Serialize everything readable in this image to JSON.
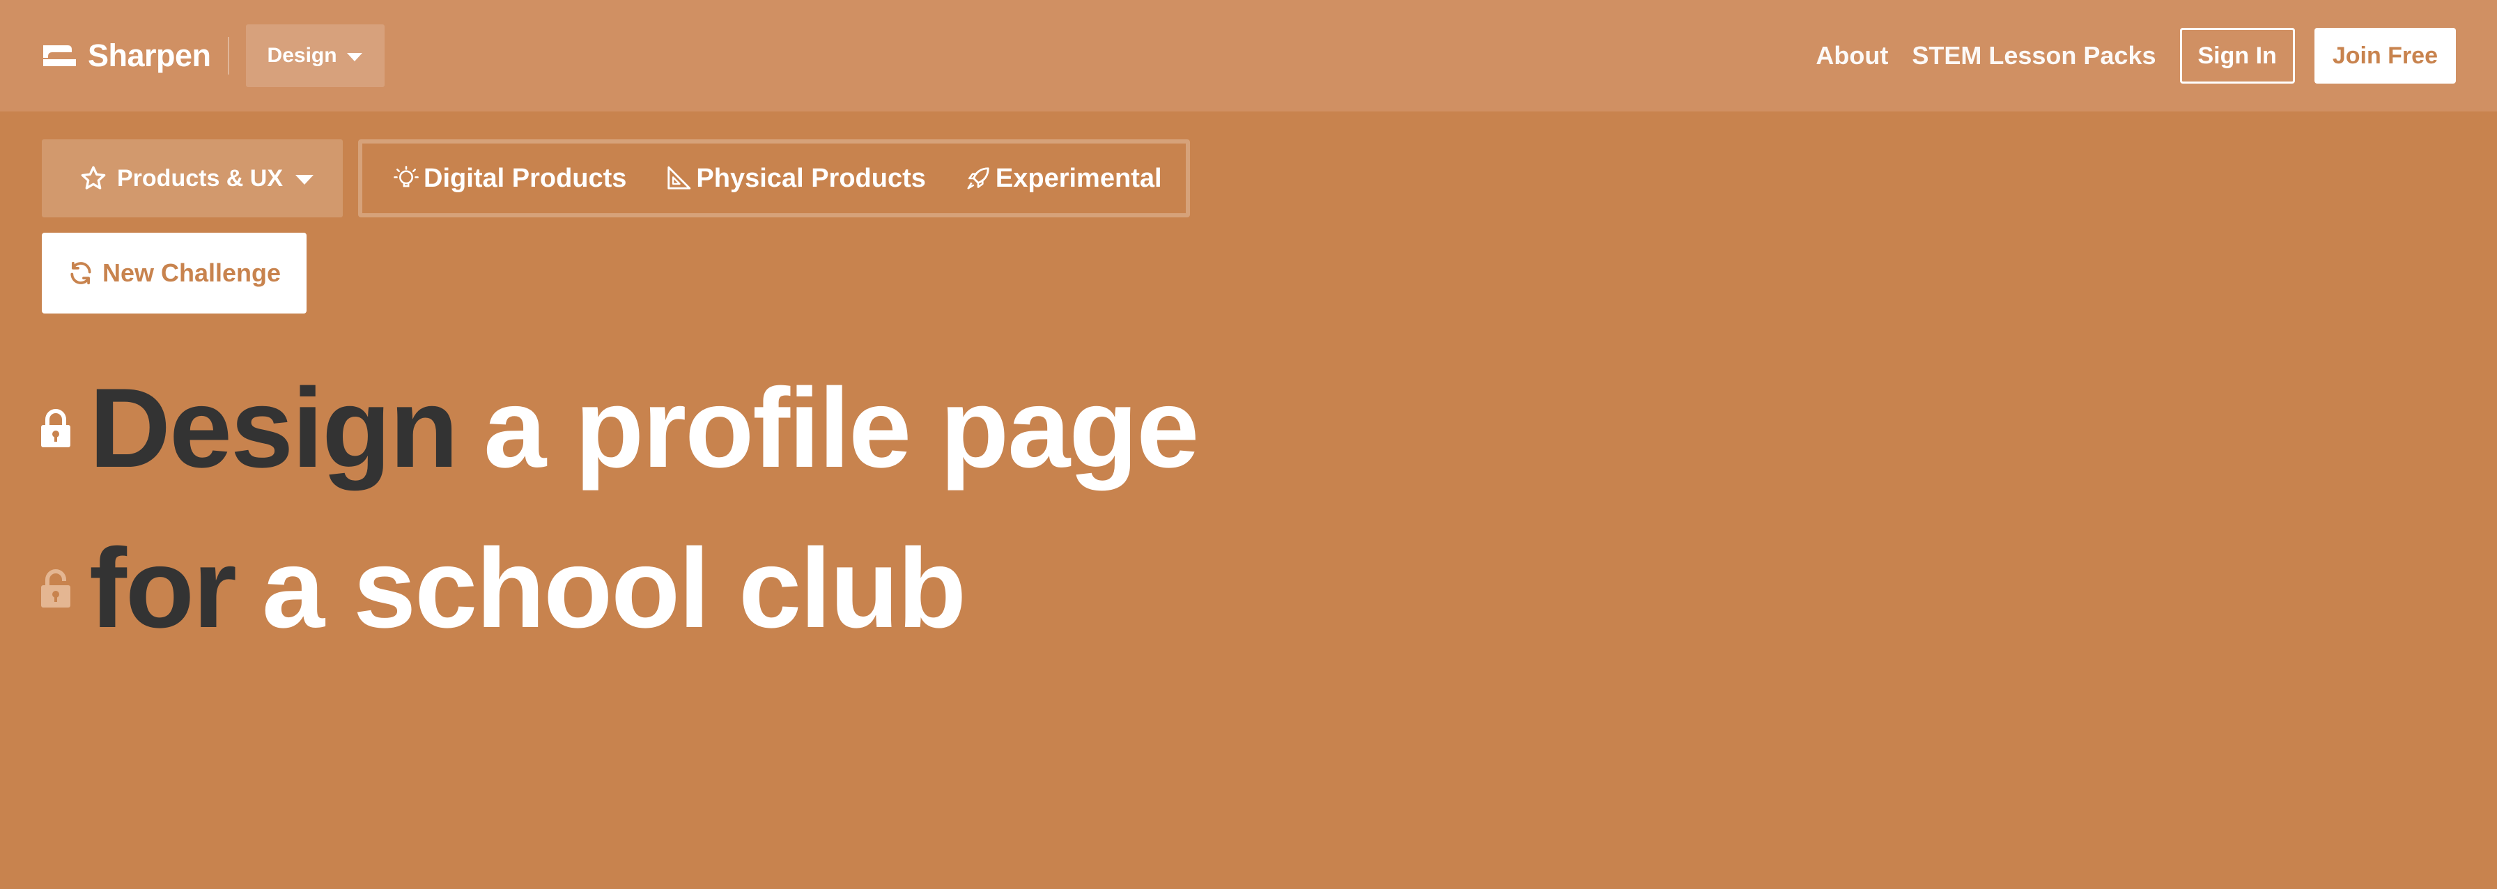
{
  "header": {
    "brand": "Sharpen",
    "category_dropdown": "Design",
    "nav_links": [
      "About",
      "STEM Lesson Packs"
    ],
    "sign_in": "Sign In",
    "join": "Join Free"
  },
  "filters": {
    "focus": "Products & UX",
    "tabs": [
      {
        "label": "Digital Products",
        "icon": "lightbulb-icon"
      },
      {
        "label": "Physical Products",
        "icon": "set-square-icon"
      },
      {
        "label": "Experimental",
        "icon": "rocket-icon"
      }
    ]
  },
  "new_challenge": "New Challenge",
  "challenge": {
    "line1": {
      "locked_word": "Design",
      "text": "a profile page",
      "lock_state": "locked"
    },
    "line2": {
      "locked_word": "for",
      "text": "a school club",
      "lock_state": "unlocked"
    }
  },
  "colors": {
    "background": "#c8834e",
    "header": "#d09063",
    "dark_text": "#333333",
    "light_text": "#ffffff"
  }
}
